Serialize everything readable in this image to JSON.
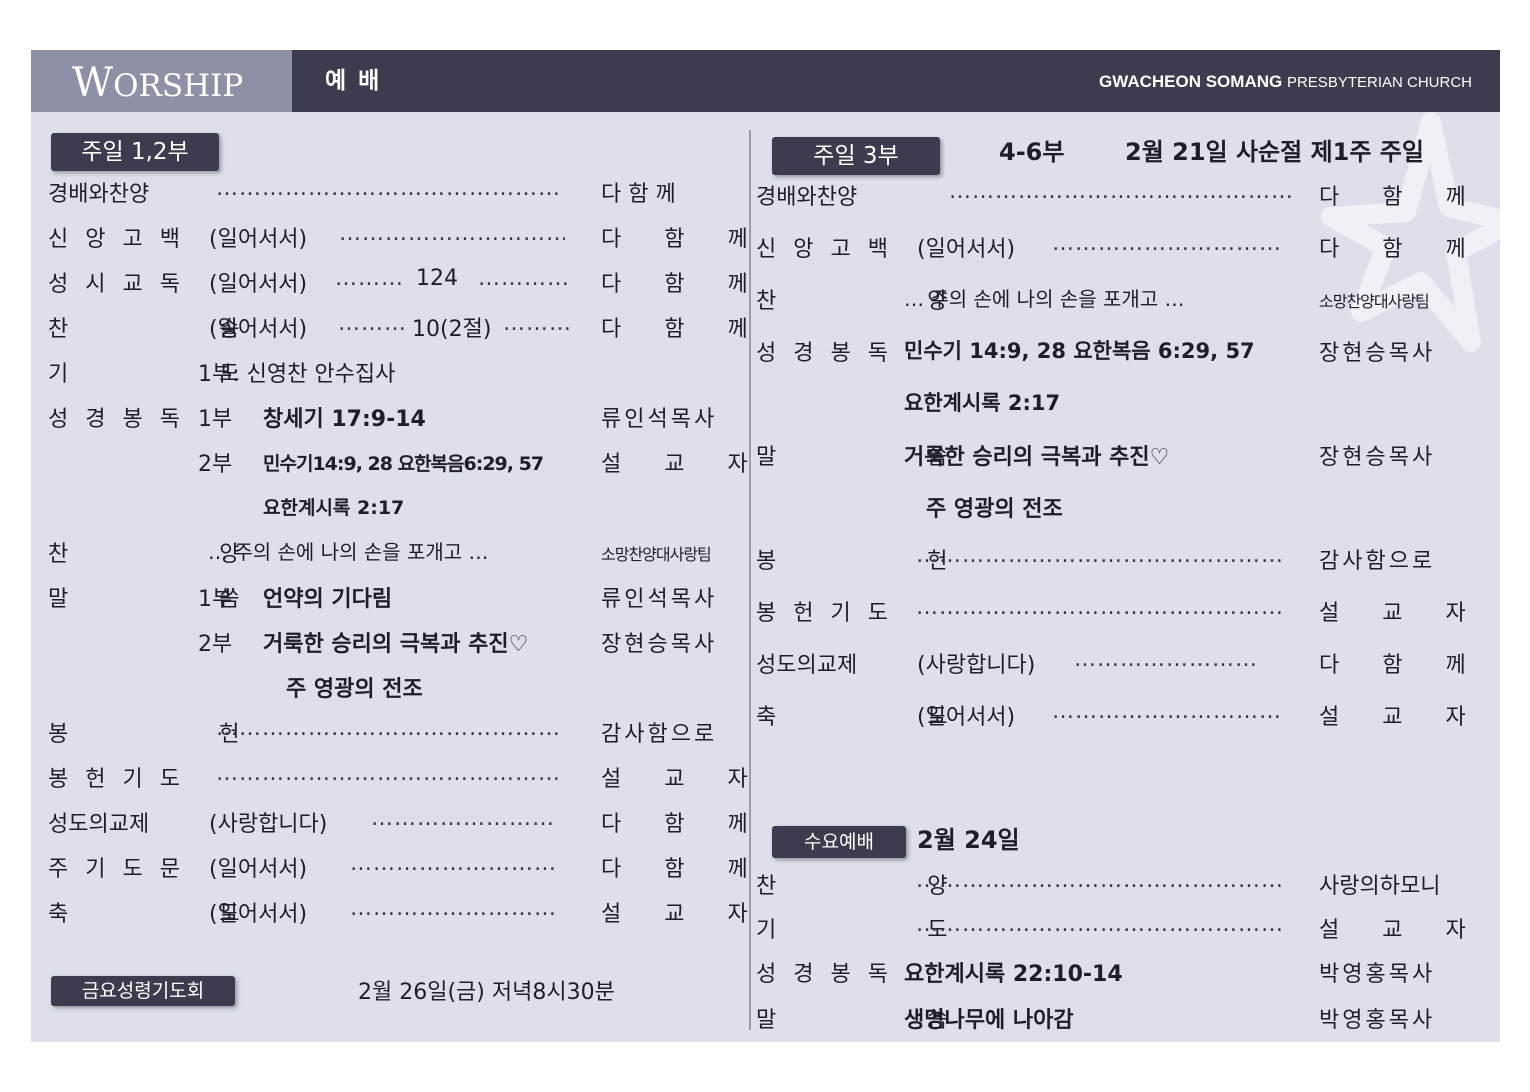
{
  "header": {
    "wordmark_big": "W",
    "wordmark_rest": "ORSHIP",
    "korean_title": "예 배",
    "church_bold": "GWACHEON SOMANG",
    "church_light": "PRESBYTERIAN CHURCH"
  },
  "left": {
    "badge": "주일 1,2부",
    "rows": {
      "r1": {
        "label": "경배와찬양",
        "dots": "…………………………………………",
        "who": "다 함 께"
      },
      "r2": {
        "label": "신 앙 고 백",
        "note": "(일어서서)",
        "dots": "…………………………………",
        "who": "다 함 께"
      },
      "r3": {
        "label": "성 시 교 독",
        "note": "(일어서서)",
        "dots1": "………",
        "mid": "124",
        "dots2": "…………",
        "who": "다 함 께"
      },
      "r4": {
        "label": "찬 송",
        "note": "(일어서서)",
        "dots1": "………",
        "mid": "10(2절)",
        "dots2": "………",
        "who": "다 함 께"
      },
      "r5": {
        "label": "기 도",
        "text": "1부: 신영찬 안수집사"
      },
      "r6": {
        "label": "성 경 봉 독",
        "part": "1부",
        "text": "창세기 17:9-14",
        "who": "류인석목사"
      },
      "r7": {
        "part": "2부",
        "text": "민수기14:9, 28  요한복음6:29, 57",
        "who": "설 교 자"
      },
      "r8": {
        "text": "요한계시록 2:17"
      },
      "r9": {
        "label": "찬 양",
        "text": "… 주의 손에 나의 손을 포개고 …",
        "who": "소망찬양대사랑팀"
      },
      "r10": {
        "label": "말 씀",
        "part": "1부",
        "text": "언약의 기다림",
        "who": "류인석목사"
      },
      "r11": {
        "part": "2부",
        "text": "거룩한 승리의 극복과 추진♡",
        "who": "장현승목사"
      },
      "r12": {
        "text": "주 영광의 전조"
      },
      "r13": {
        "label": "봉 헌",
        "dots": "…………………………………………",
        "who": "감사함으로"
      },
      "r14": {
        "label": "봉 헌 기 도",
        "dots": "…………………………………………",
        "who": "설 교 자"
      },
      "r15": {
        "label": "성도의교제",
        "note": "(사랑합니다)",
        "dots": "……………………",
        "who": "다 함 께"
      },
      "r16": {
        "label": "주 기 도 문",
        "note": "(일어서서)",
        "dots": "…………………………",
        "who": "다 함 께"
      },
      "r17": {
        "label": "축 도",
        "note": "(일어서서)",
        "dots": "…………………………",
        "who": "설 교 자"
      }
    },
    "friday": {
      "badge": "금요성령기도회",
      "text": "2월 26일(금) 저녁8시30분"
    }
  },
  "right": {
    "badge": "주일 3부",
    "sub": "4-6부",
    "date": "2월 21일 사순절 제1주 주일",
    "rows": {
      "r1": {
        "label": "경배와찬양",
        "dots": "…………………………………………",
        "who": "다 함 께"
      },
      "r2": {
        "label": "신 앙 고 백",
        "note": "(일어서서)",
        "dots": "…………………………",
        "who": "다 함 께"
      },
      "r3": {
        "label": "찬 양",
        "text": "…  주의 손에 나의 손을 포개고  …",
        "who": "소망찬양대사랑팀"
      },
      "r4": {
        "label": "성 경 봉 독",
        "text": "민수기 14:9, 28  요한복음 6:29, 57",
        "who": "장현승목사"
      },
      "r5": {
        "text": "요한계시록 2:17"
      },
      "r6": {
        "label": "말 씀",
        "text": "거룩한 승리의 극복과 추진♡",
        "who": "장현승목사"
      },
      "r7": {
        "text": "주 영광의 전조"
      },
      "r8": {
        "label": "봉 헌",
        "dots": "……………………………………………",
        "who": "감사함으로"
      },
      "r9": {
        "label": "봉 헌 기 도",
        "dots": "……………………………………………",
        "who": "설 교 자"
      },
      "r10": {
        "label": "성도의교제",
        "note": "(사랑합니다)",
        "dots": "……………………",
        "who": "다 함 께"
      },
      "r11": {
        "label": "축 도",
        "note": "(일어서서)",
        "dots": "…………………………",
        "who": "설 교 자"
      }
    },
    "wednesday": {
      "badge": "수요예배",
      "date": "2월 24일",
      "rows": {
        "w1": {
          "label": "찬 양",
          "dots": "……………………………………………",
          "who": "사랑의하모니"
        },
        "w2": {
          "label": "기 도",
          "dots": "……………………………………………",
          "who": "설 교 자"
        },
        "w3": {
          "label": "성 경 봉 독",
          "text": "요한계시록 22:10-14",
          "who": "박영홍목사"
        },
        "w4": {
          "label": "말 씀",
          "text": "생명나무에 나아감",
          "who": "박영홍목사"
        }
      }
    }
  }
}
